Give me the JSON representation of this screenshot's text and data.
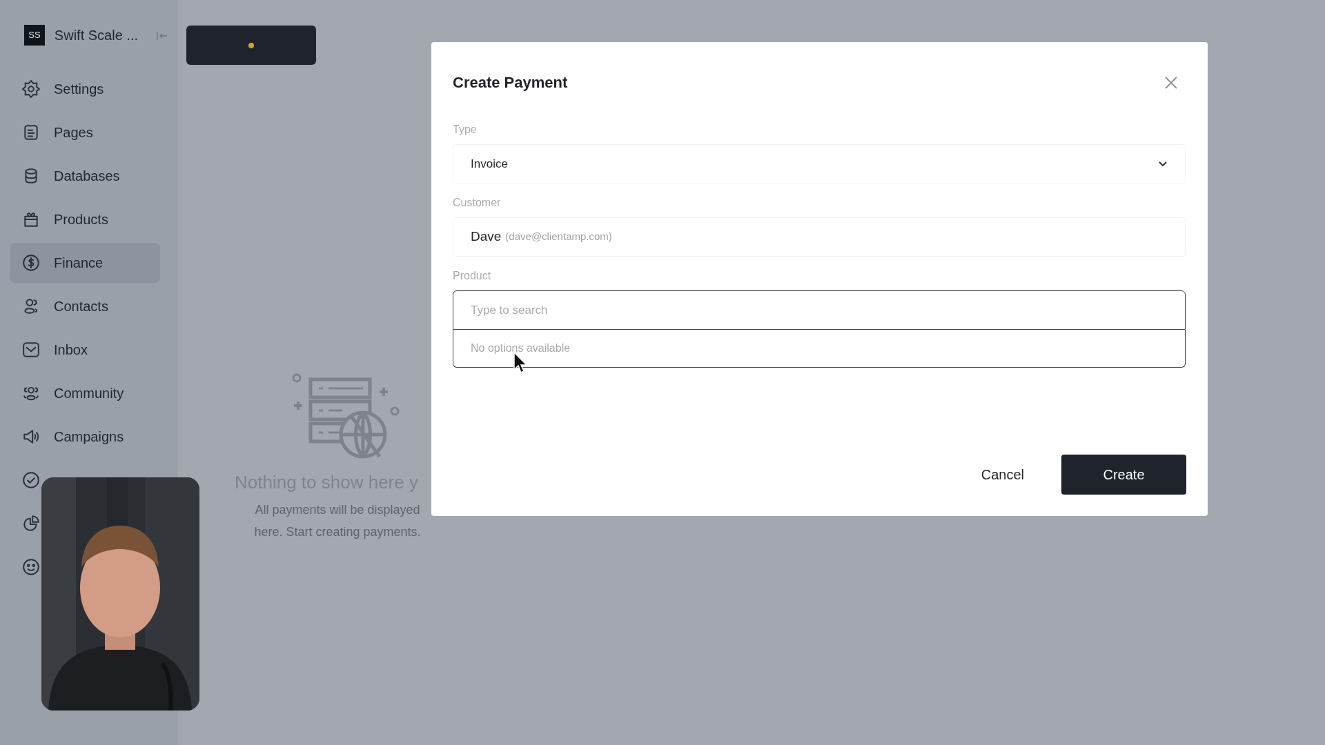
{
  "sidebar": {
    "logo": "SS",
    "workspace": "Swift Scale ...",
    "items": [
      {
        "label": "Settings",
        "selected": false
      },
      {
        "label": "Pages",
        "selected": false
      },
      {
        "label": "Databases",
        "selected": false
      },
      {
        "label": "Products",
        "selected": false
      },
      {
        "label": "Finance",
        "selected": true
      },
      {
        "label": "Contacts",
        "selected": false
      },
      {
        "label": "Inbox",
        "selected": false
      },
      {
        "label": "Community",
        "selected": false
      },
      {
        "label": "Campaigns",
        "selected": false
      }
    ]
  },
  "empty_state": {
    "title": "Nothing to show here y",
    "text": "All payments will be displayed here. Start creating payments."
  },
  "modal": {
    "title": "Create Payment",
    "fields": [
      {
        "kind": "select",
        "label": "Type",
        "value": "Invoice"
      },
      {
        "kind": "customer",
        "label": "Customer",
        "value": "Dave",
        "detail": "(dave@clientamp.com)"
      },
      {
        "kind": "combobox",
        "label": "Product",
        "placeholder": "Type to search",
        "expanded": true,
        "empty_message": "No options available"
      }
    ],
    "buttons": [
      {
        "label": "Cancel",
        "kind": "secondary"
      },
      {
        "label": "Create",
        "kind": "primary"
      }
    ]
  }
}
